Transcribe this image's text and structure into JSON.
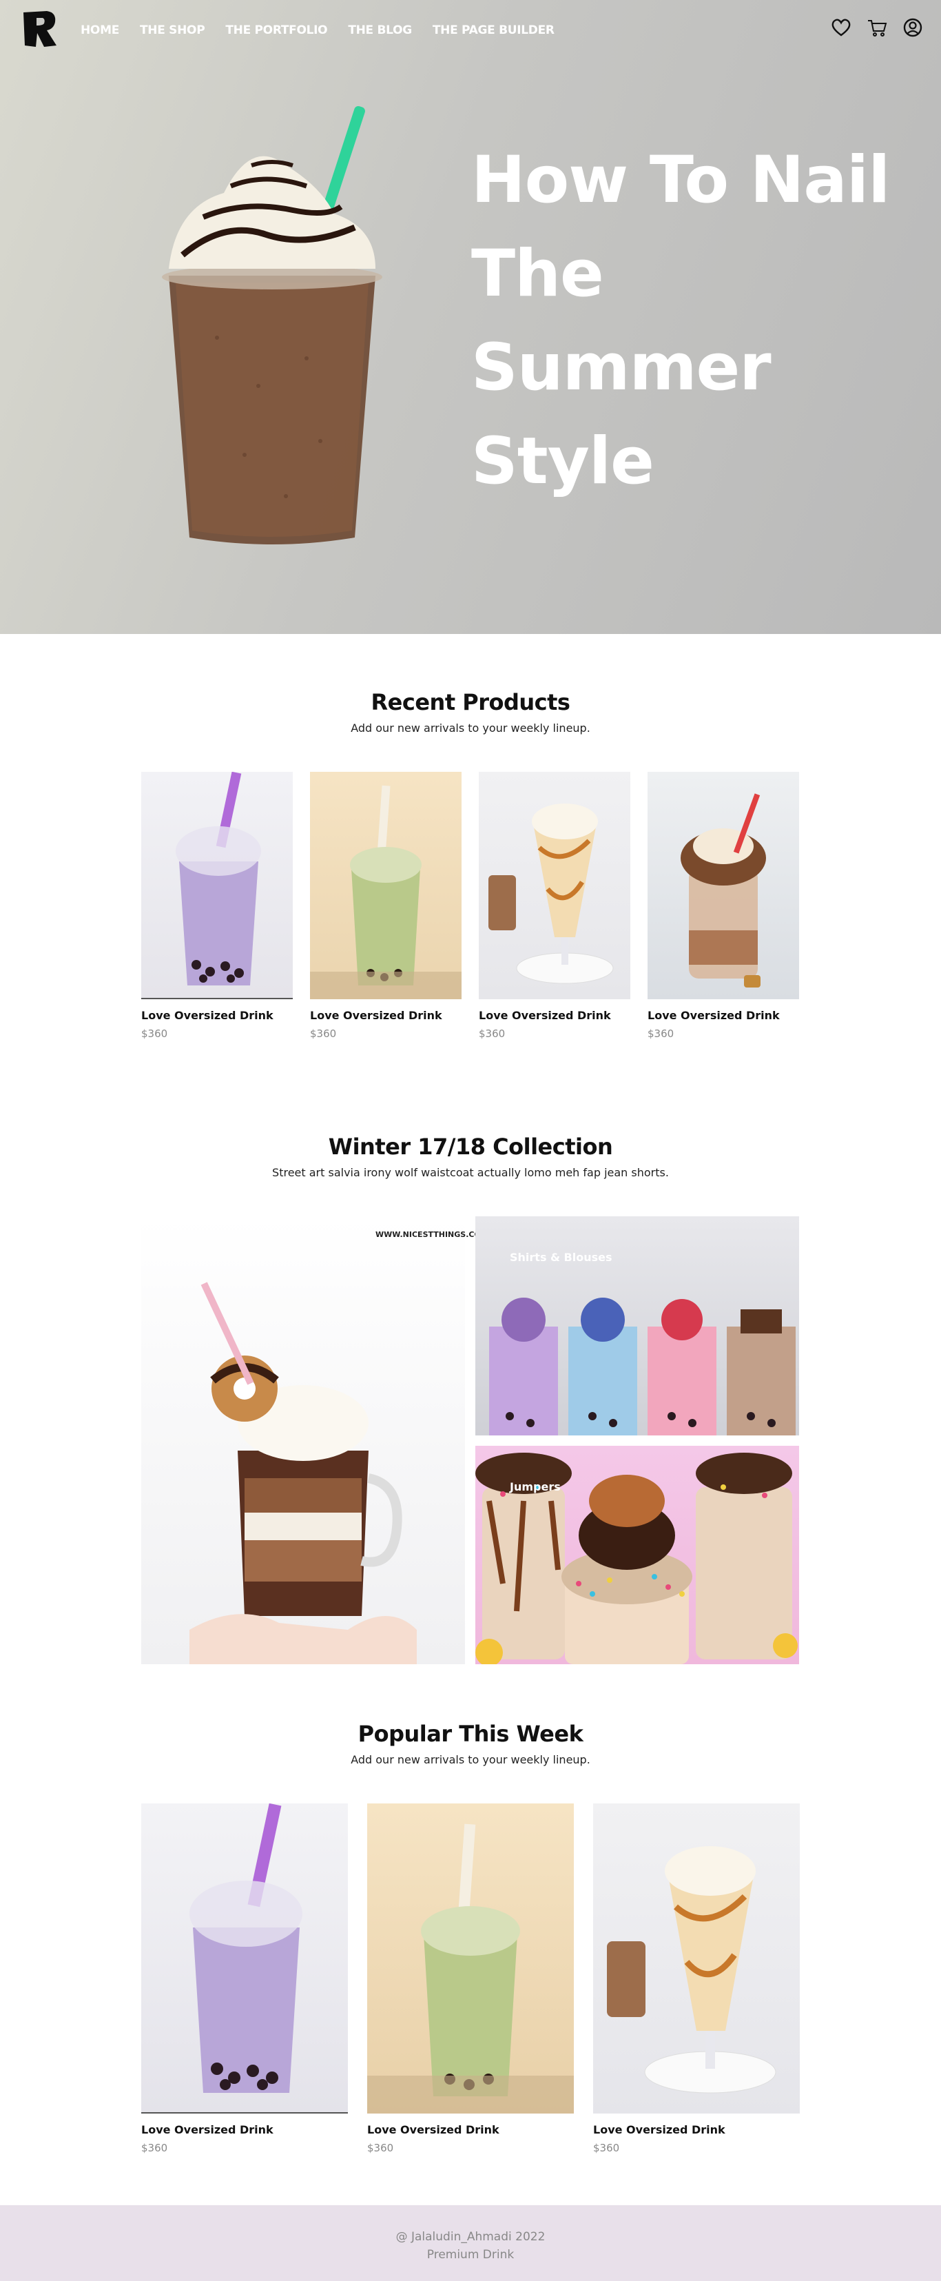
{
  "nav": {
    "logo_alt": "R",
    "items": [
      "HOME",
      "THE SHOP",
      "THE PORTFOLIO",
      "THE BLOG",
      "THE PAGE BUILDER"
    ],
    "icons": [
      "heart-icon",
      "cart-icon",
      "user-icon"
    ]
  },
  "hero": {
    "title_lines": [
      "How To Nail",
      "The",
      "Summer",
      "Style"
    ]
  },
  "recent": {
    "title": "Recent Products",
    "subtitle": "Add our new arrivals to your weekly lineup.",
    "products": [
      {
        "name": "Love Oversized Drink",
        "price": "$360"
      },
      {
        "name": "Love Oversized Drink",
        "price": "$360"
      },
      {
        "name": "Love Oversized Drink",
        "price": "$360"
      },
      {
        "name": "Love Oversized Drink",
        "price": "$360"
      }
    ]
  },
  "collection": {
    "title": "Winter 17/18 Collection",
    "subtitle": "Street art salvia irony wolf waistcoat actually lomo meh fap jean shorts.",
    "watermark": "WWW.NICESTTHINGS.COM",
    "label_shirts": "Shirts & Blouses",
    "label_jumpers": "Jumpers"
  },
  "popular": {
    "title": "Popular This Week",
    "subtitle": "Add our new arrivals to your weekly lineup.",
    "products": [
      {
        "name": "Love Oversized Drink",
        "price": "$360"
      },
      {
        "name": "Love Oversized Drink",
        "price": "$360"
      },
      {
        "name": "Love Oversized Drink",
        "price": "$360"
      }
    ]
  },
  "footer": {
    "copyright": "@ Jalaludin_Ahmadi 2022",
    "tagline": "Premium Drink"
  },
  "colors": {
    "hero_bg": "#c4c4c0",
    "footer_bg": "#e8e0ea",
    "taro": "#b8a6d8",
    "matcha": "#b9c98a",
    "caramel": "#e8c48a",
    "straw": "#2fd39a"
  }
}
